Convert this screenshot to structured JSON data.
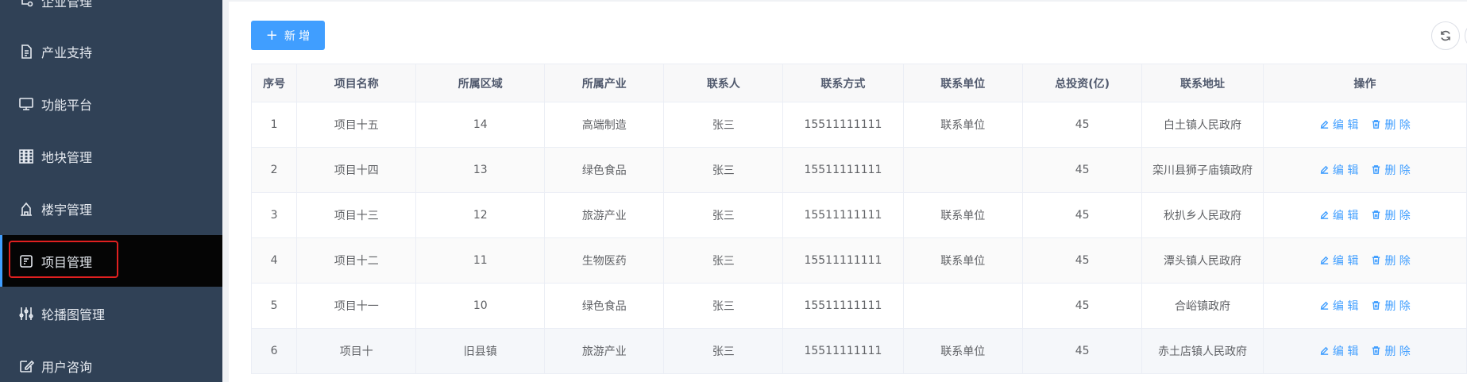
{
  "sidebar": {
    "items": [
      {
        "label": "企业管理",
        "icon": "enterprise-icon"
      },
      {
        "label": "产业支持",
        "icon": "document-icon"
      },
      {
        "label": "功能平台",
        "icon": "monitor-icon"
      },
      {
        "label": "地块管理",
        "icon": "plots-icon"
      },
      {
        "label": "楼宇管理",
        "icon": "building-icon"
      },
      {
        "label": "项目管理",
        "icon": "project-icon"
      },
      {
        "label": "轮播图管理",
        "icon": "sliders-icon"
      },
      {
        "label": "用户咨询",
        "icon": "edit-icon"
      }
    ],
    "active_index": 5
  },
  "toolbar": {
    "add_label": "新 增",
    "refresh_icon": "refresh-icon"
  },
  "table": {
    "headers": [
      "序号",
      "项目名称",
      "所属区域",
      "所属产业",
      "联系人",
      "联系方式",
      "联系单位",
      "总投资(亿)",
      "联系地址",
      "操作"
    ],
    "rows": [
      [
        "1",
        "项目十五",
        "14",
        "高端制造",
        "张三",
        "15511111111",
        "联系单位",
        "45",
        "白土镇人民政府"
      ],
      [
        "2",
        "项目十四",
        "13",
        "绿色食品",
        "张三",
        "15511111111",
        "",
        "45",
        "栾川县狮子庙镇政府"
      ],
      [
        "3",
        "项目十三",
        "12",
        "旅游产业",
        "张三",
        "15511111111",
        "联系单位",
        "45",
        "秋扒乡人民政府"
      ],
      [
        "4",
        "项目十二",
        "11",
        "生物医药",
        "张三",
        "15511111111",
        "联系单位",
        "45",
        "潭头镇人民政府"
      ],
      [
        "5",
        "项目十一",
        "10",
        "绿色食品",
        "张三",
        "15511111111",
        "",
        "45",
        "合峪镇政府"
      ],
      [
        "6",
        "项目十",
        "旧县镇",
        "旅游产业",
        "张三",
        "15511111111",
        "联系单位",
        "45",
        "赤土店镇人民政府"
      ]
    ],
    "edit_label": "编 辑",
    "delete_label": "删 除"
  },
  "colors": {
    "sidebar_bg": "#304156",
    "active_bg": "#050505",
    "primary": "#409eff",
    "highlight_border": "#e02020"
  }
}
